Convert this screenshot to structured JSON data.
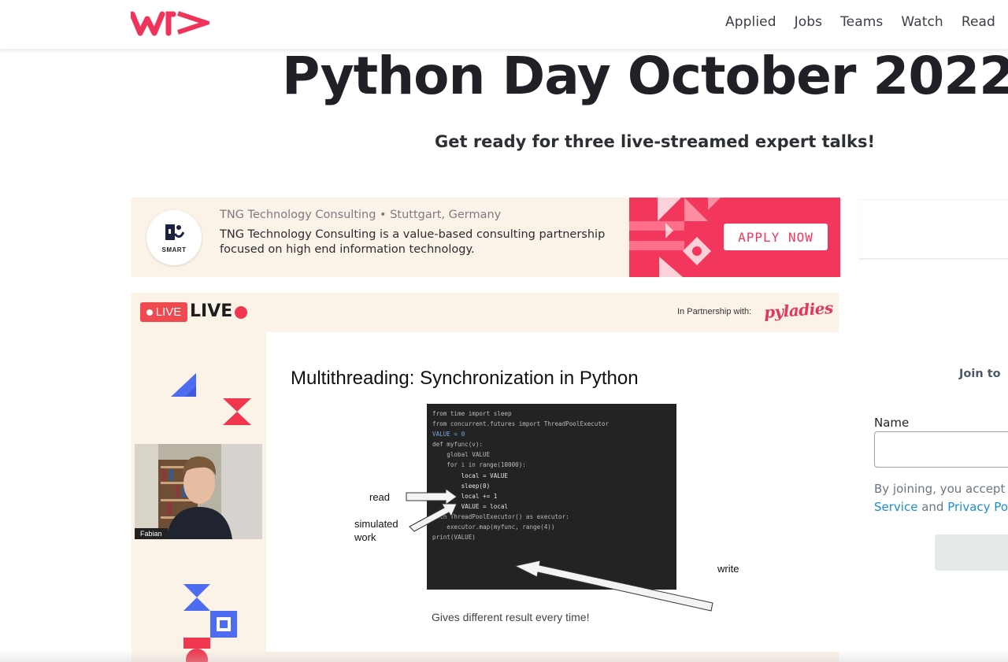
{
  "brand": {
    "logo": "wm-logo",
    "accent": "#f0335a"
  },
  "nav": {
    "items": [
      "Applied",
      "Jobs",
      "Teams",
      "Watch",
      "Read"
    ]
  },
  "page": {
    "title": "Python Day October 2022",
    "subtitle": "Get ready for three live-streamed expert talks!"
  },
  "ad": {
    "company_meta": "TNG Technology Consulting • Stuttgart, Germany",
    "description": "TNG Technology Consulting is a value-based consulting partnership focused on high end information technology.",
    "logo_text": "SMART",
    "cta": "APPLY NOW",
    "cta_color": "#f3365c"
  },
  "stream": {
    "badge": "LIVE",
    "live_label": "LIVE",
    "partner_text": "In Partnership with:",
    "partner_name": "pyladies",
    "speaker_name": "Fabian",
    "slide": {
      "title": "Multithreading: Synchronization in Python",
      "code_lines": [
        "from time import sleep",
        "from concurrent.futures import ThreadPoolExecutor",
        "",
        "VALUE = 0",
        "",
        "def myfunc(v):",
        "    global VALUE",
        "    for i in range(10000):",
        "        local = VALUE",
        "        sleep(0)",
        "        local += 1",
        "        VALUE = local",
        "",
        "with ThreadPoolExecutor() as executor:",
        "    executor.map(myfunc, range(4))",
        "",
        "print(VALUE)"
      ],
      "label_read": "read",
      "label_simulated_1": "simulated",
      "label_simulated_2": "work",
      "label_write": "write",
      "footer": "Gives different result every time!"
    }
  },
  "form": {
    "join_text": "Join to",
    "name_label": "Name",
    "name_value": "",
    "terms_line1": "By joining, you accept",
    "terms_link1": "Service",
    "terms_and": "and",
    "terms_link2": "Privacy Po"
  }
}
